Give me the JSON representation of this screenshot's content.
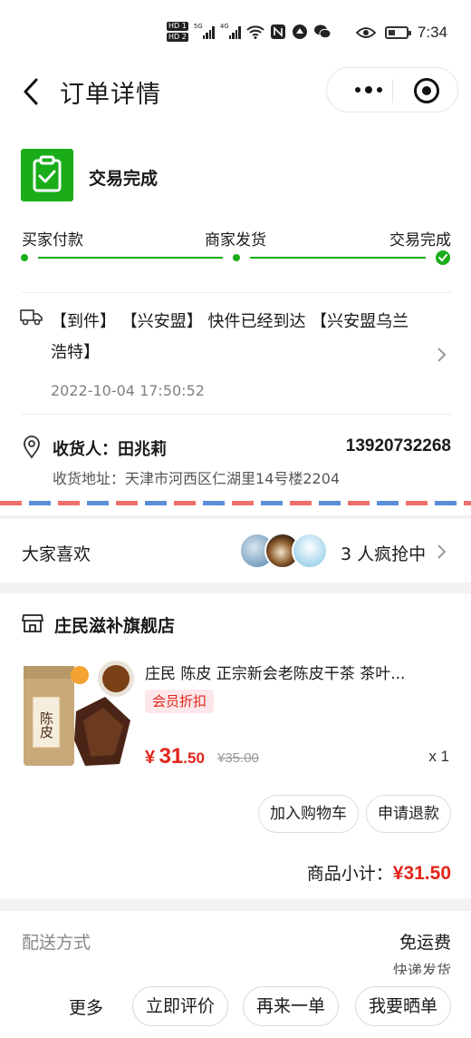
{
  "status_bar": {
    "time": "7:34",
    "sim1": "HD 1",
    "sim2": "HD 2",
    "net1": "5G",
    "net2": "4G"
  },
  "nav": {
    "title": "订单详情"
  },
  "order_status": {
    "title": "交易完成",
    "steps": [
      "买家付款",
      "商家发货",
      "交易完成"
    ],
    "current_step": 3,
    "accent": "#1aad19"
  },
  "logistics": {
    "text": "【到件】 【兴安盟】 快件已经到达 【兴安盟乌兰浩特】",
    "time": "2022-10-04 17:50:52"
  },
  "receiver": {
    "label": "收货人：",
    "name": "田兆莉",
    "phone": "13920732268",
    "address_label": "收货地址：",
    "address": "天津市河西区仁湖里14号楼2204"
  },
  "likes": {
    "title": "大家喜欢",
    "count_text": "3 人疯抢中"
  },
  "shop": {
    "name": "庄民滋补旗舰店"
  },
  "product": {
    "title": "庄民 陈皮 正宗新会老陈皮干茶 茶叶...",
    "tag": "会员折扣",
    "price_symbol": "¥",
    "price_int": "31",
    "price_dec": ".50",
    "original_price": "¥35.00",
    "quantity": "x 1",
    "image_text": "陈皮"
  },
  "actions": {
    "add_cart": "加入购物车",
    "refund": "申请退款"
  },
  "subtotal": {
    "label": "商品小计：",
    "value": "¥31.50",
    "color": "#e1251b"
  },
  "shipping": {
    "label": "配送方式",
    "value": "免运费",
    "sub": "快递发货"
  },
  "bottom_bar": {
    "more": "更多",
    "review": "立即评价",
    "reorder": "再来一单",
    "share": "我要晒单"
  }
}
